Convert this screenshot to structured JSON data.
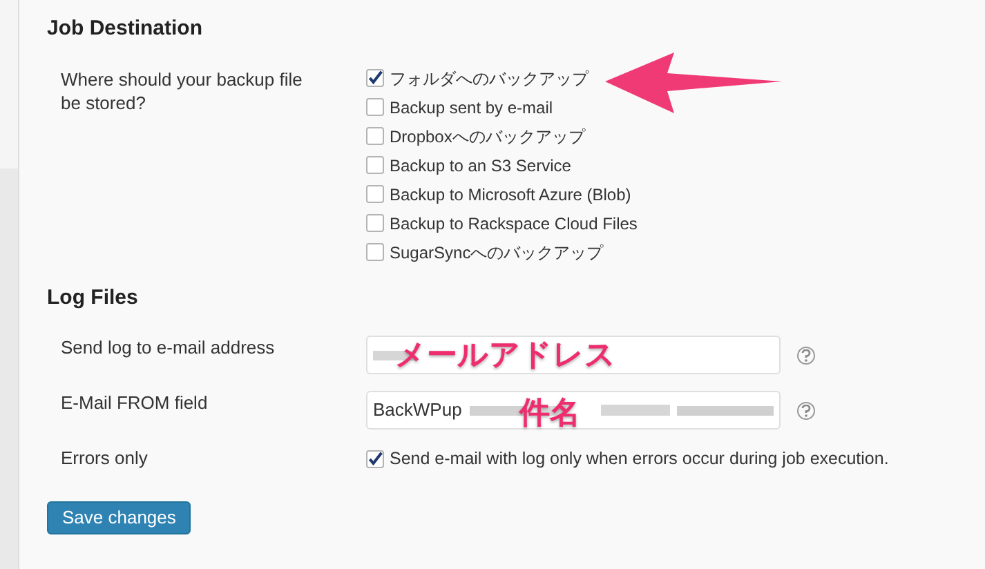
{
  "sections": [
    {
      "title": "Job Destination",
      "rows": [
        {
          "kind": "checklist",
          "label": "Where should your backup file be stored?",
          "options": [
            {
              "label": "フォルダへのバックアップ",
              "checked": true
            },
            {
              "label": "Backup sent by e-mail",
              "checked": false
            },
            {
              "label": "Dropboxへのバックアップ",
              "checked": false
            },
            {
              "label": "Backup to an S3 Service",
              "checked": false
            },
            {
              "label": "Backup to Microsoft Azure (Blob)",
              "checked": false
            },
            {
              "label": "Backup to Rackspace Cloud Files",
              "checked": false
            },
            {
              "label": "SugarSyncへのバックアップ",
              "checked": false
            }
          ]
        }
      ]
    },
    {
      "title": "Log Files",
      "rows": [
        {
          "kind": "field",
          "label": "Send log to e-mail address",
          "value": "",
          "annotation": "メールアドレス"
        },
        {
          "kind": "field",
          "label": "E-Mail FROM field",
          "value": "BackWPup",
          "annotation": "件名"
        },
        {
          "kind": "checkbox",
          "label": "Errors only",
          "option": {
            "label": "Send e-mail with log only when errors occur during job execution.",
            "checked": true
          }
        }
      ]
    }
  ],
  "save_button": "Save changes"
}
